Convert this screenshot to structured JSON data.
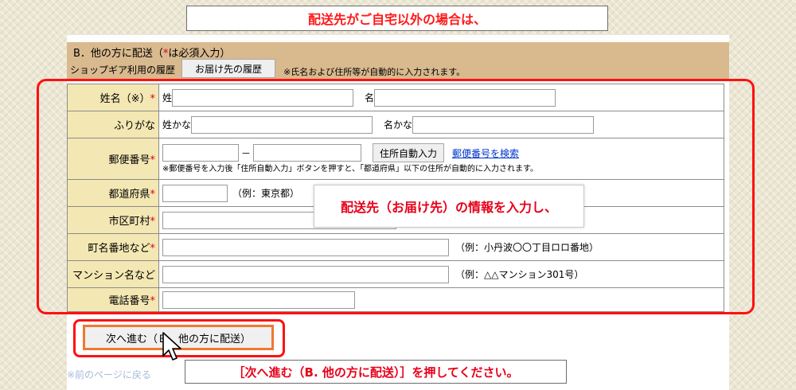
{
  "callout_top": "配送先がご自宅以外の場合は、",
  "section": {
    "title": "B．他の方に配送（",
    "title_star": "*",
    "title_suffix": "は必須入力）",
    "history_label": "ショップギア利用の履歴",
    "history_button": "お届け先の履歴",
    "history_note": "※氏名および住所等が自動的に入力されます。"
  },
  "form": {
    "name_label": "姓名（※）",
    "required_mark": "*",
    "sei_prefix": "姓",
    "mei_prefix": "名",
    "kana_label": "ふりがな",
    "sei_kana_prefix": "姓かな",
    "mei_kana_prefix": "名かな",
    "postal_label": "郵便番号",
    "postal_dash": "－",
    "auto_address_button": "住所自動入力",
    "postal_search_link": "郵便番号を検索",
    "postal_note": "※郵便番号を入力後「住所自動入力」ボタンを押すと、「都道府県」以下の住所が自動的に入力されます。",
    "pref_label": "都道府県",
    "pref_example": "（例：東京都）",
    "city_label": "市区町村",
    "town_label": "町名番地など",
    "town_example": "（例：小丹波〇〇丁目ロロ番地）",
    "building_label": "マンション名など",
    "building_example": "（例：△△マンション301号）",
    "phone_label": "電話番号"
  },
  "callout_mid": "配送先（お届け先）の情報を入力し、",
  "next_button": "次へ進む（Ｂ．他の方に配送）",
  "callout_bottom": "［次へ進む（B. 他の方に配送）］を押してください。",
  "faded_text": "※前のページに戻る"
}
